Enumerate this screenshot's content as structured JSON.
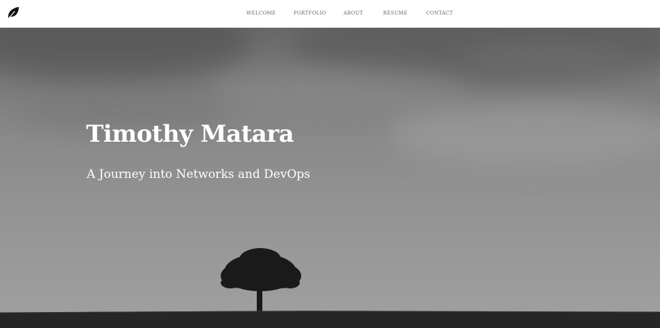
{
  "nav": {
    "logo_icon": "leaf-icon",
    "items": [
      {
        "label": "WELCOME"
      },
      {
        "label": "PORTFOLIO"
      },
      {
        "label": "ABOUT"
      },
      {
        "label": "RESUME"
      },
      {
        "label": "CONTACT"
      }
    ]
  },
  "hero": {
    "title": "Timothy Matara",
    "subtitle": "A Journey into Networks and DevOps",
    "background": "black-and-white landscape with a lone tree",
    "text_color": "#ffffff"
  }
}
